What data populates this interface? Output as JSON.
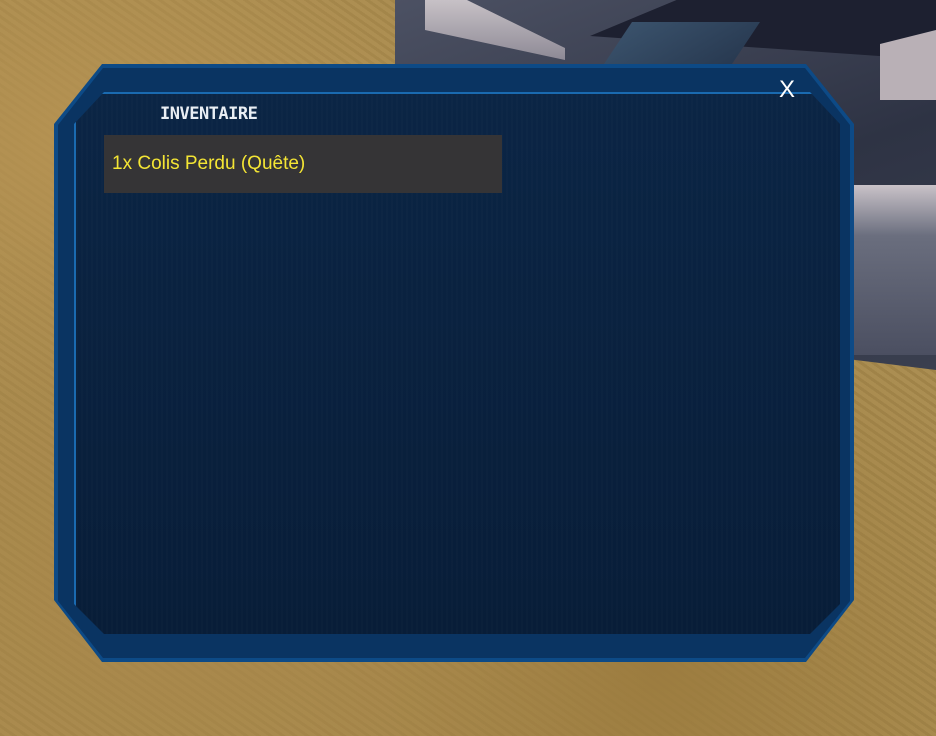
{
  "window": {
    "title": "INVENTAIRE",
    "close_label": "X"
  },
  "inventory": {
    "items": [
      {
        "label": "1x Colis Perdu (Quête)"
      }
    ]
  },
  "colors": {
    "panel_border": "#0d4a86",
    "panel_bg": "#081d38",
    "item_bg": "#353436",
    "item_text": "#f4e534",
    "title_text": "#e9eef4"
  }
}
